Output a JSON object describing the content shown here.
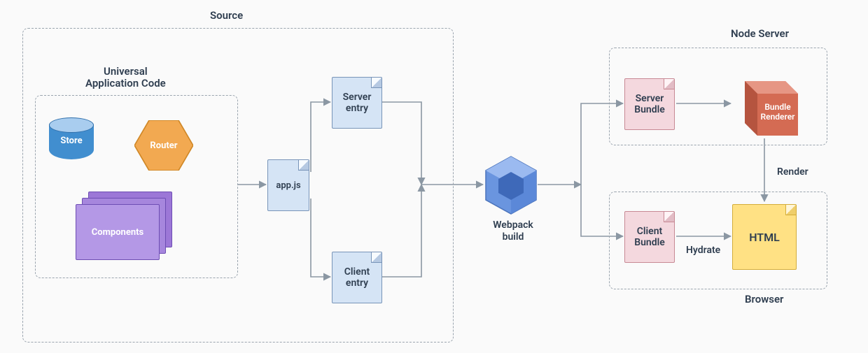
{
  "titles": {
    "source": "Source",
    "universal": "Universal\nApplication Code",
    "node_server": "Node Server",
    "browser": "Browser"
  },
  "nodes": {
    "store": "Store",
    "router": "Router",
    "components": "Components",
    "app_js": "app.js",
    "server_entry": "Server\nentry",
    "client_entry": "Client\nentry",
    "webpack_build": "Webpack\nbuild",
    "server_bundle": "Server\nBundle",
    "client_bundle": "Client\nBundle",
    "bundle_renderer": "Bundle\nRenderer",
    "html": "HTML"
  },
  "edges": {
    "render": "Render",
    "hydrate": "Hydrate"
  },
  "colors": {
    "blue_fill": "#d5e4f5",
    "pink_fill": "#f4d8de",
    "yellow_fill": "#ffe184",
    "cylinder": "#418ecf",
    "hexagon": "#f2a951",
    "components": "#9c77d7",
    "webpack_cube": "#5b88d8",
    "renderer_cube": "#d36a51",
    "arrow": "#8b97a3",
    "dash_border": "#9aa4ae"
  }
}
